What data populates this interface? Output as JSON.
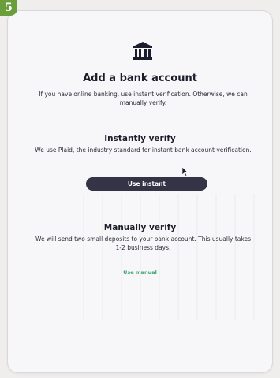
{
  "step_badge": "5",
  "icons": {
    "bank": "bank-building-icon",
    "cursor": "mouse-pointer-icon"
  },
  "header": {
    "title": "Add a bank account",
    "subtitle": "If you have online banking, use instant verification. Otherwise, we can manually verify."
  },
  "instant": {
    "title": "Instantly verify",
    "body": "We use Plaid, the industry standard for instant bank account verification.",
    "button_label": "Use instant"
  },
  "manual": {
    "title": "Manually verify",
    "body": "We will send two small deposits to your bank account. This usually takes 1-2 business days.",
    "link_label": "Use manual"
  },
  "colors": {
    "badge": "#6a9e3a",
    "button": "#343446",
    "link": "#3aa86a",
    "text": "#1c1d2a"
  }
}
